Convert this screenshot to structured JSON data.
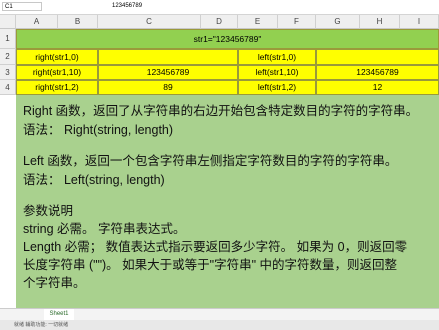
{
  "formula_bar": {
    "name_box": "C1",
    "fx": "",
    "value": "123456789"
  },
  "columns": [
    "A",
    "B",
    "C",
    "D",
    "E",
    "F",
    "G",
    "H",
    "I"
  ],
  "rows": [
    "1",
    "2",
    "3",
    "4"
  ],
  "table": {
    "header": "str1=\"123456789\"",
    "r2": {
      "a": "right(str1,0)",
      "f": "left(str1,0)"
    },
    "r3": {
      "a": "right(str1,10)",
      "c": "123456789",
      "f": "left(str1,10)",
      "h": "123456789"
    },
    "r4": {
      "a": "right(str1,2)",
      "c": "89",
      "f": "left(str1,2)",
      "h": "12"
    }
  },
  "notes": [
    "Right 函数，返回了从字符串的右边开始包含特定数目的字符的字符串。",
    "语法：  Right(string, length)",
    "",
    "Left 函数，返回一个包含字符串左侧指定字符数目的字符的字符串。",
    "语法：  Left(string, length)",
    "",
    "参数说明",
    "string  必需。  字符串表达式。",
    "Length  必需；  数值表达式指示要返回多少字符。  如果为 0，则返回零",
    "长度字符串 (\"\")。  如果大于或等于\"字符串\" 中的字符数量，则返回整",
    "个字符串。"
  ],
  "sheet_tab": "Sheet1",
  "status": "就绪  辅助功能: 一切就绪",
  "colors": {
    "green": "#92d050",
    "yellow": "#ffff00",
    "notes_bg": "#a9d18e"
  }
}
